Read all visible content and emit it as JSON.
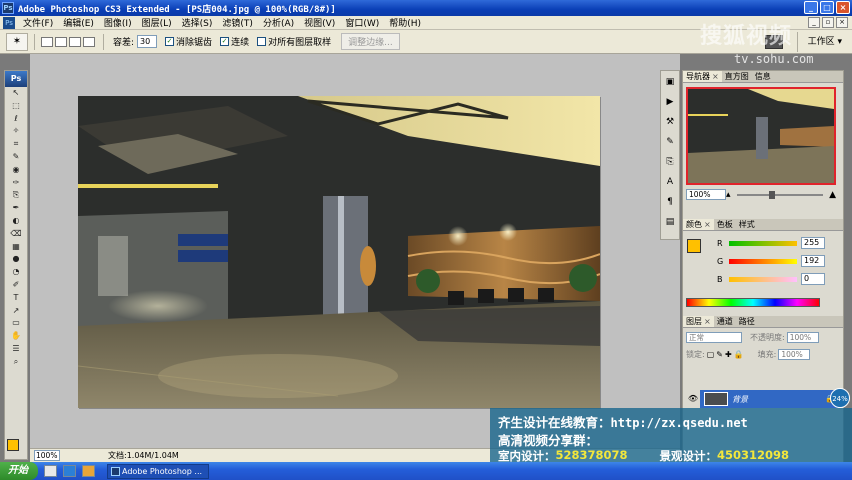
{
  "window": {
    "title": "Adobe Photoshop CS3 Extended - [PS店004.jpg @ 100%(RGB/8#)]",
    "minimize": "_",
    "maximize": "□",
    "close": "×"
  },
  "menu": {
    "items": [
      "文件(F)",
      "编辑(E)",
      "图像(I)",
      "图层(L)",
      "选择(S)",
      "滤镜(T)",
      "分析(A)",
      "视图(V)",
      "窗口(W)",
      "帮助(H)"
    ]
  },
  "options": {
    "tolerance_label": "容差:",
    "tolerance_value": "30",
    "antialias_label": "消除锯齿",
    "contiguous_label": "连续",
    "sample_all_label": "对所有图层取样",
    "refine_edge_label": "调整边缘...",
    "workspace_label": "工作区 ▾"
  },
  "toolbox": {
    "logo": "Ps",
    "tools": [
      "↖",
      "⬚",
      "ℓ",
      "✧",
      "⌗",
      "✎",
      "◉",
      "✑",
      "⎘",
      "✒",
      "◐",
      "⌫",
      "▦",
      "●",
      "◔",
      "✐",
      "T",
      "↗",
      "▭",
      "✋",
      "☰",
      "⌕"
    ]
  },
  "document": {
    "zoom": "100%",
    "doc_info": "文档:1.04M/1.04M"
  },
  "colors": {
    "foreground": "#ffc000",
    "background": "#ffffff",
    "accent_select": "#3168c4",
    "nav_frame": "#e0232b"
  },
  "navigator": {
    "tabs": [
      "导航器",
      "直方图",
      "信息"
    ],
    "zoom": "100%"
  },
  "color_panel": {
    "tabs": [
      "颜色",
      "色板",
      "样式"
    ],
    "r_label": "R",
    "g_label": "G",
    "b_label": "B",
    "r": 255,
    "g": 192,
    "b": 0
  },
  "layers_panel": {
    "tabs": [
      "图层",
      "通道",
      "路径"
    ],
    "blend_mode": "正常",
    "opacity_label": "不透明度:",
    "opacity_value": "100%",
    "lock_label": "锁定:",
    "fill_label": "填充:",
    "fill_value": "100%",
    "layer_name": "背景"
  },
  "watermark": {
    "brand": "搜狐视频",
    "url": "tv.sohu.com"
  },
  "overlay": {
    "line1_a": "齐生设计在线教育：",
    "line1_url": "http://zx.qsedu.net",
    "line2": "高清视频分享群：",
    "group1_label": "室内设计：",
    "group1_number": "528378078",
    "group2_label": "景观设计：",
    "group2_number": "450312098",
    "float_badge": "24%"
  },
  "taskbar": {
    "start": "开始",
    "task_label": "Adobe Photoshop ..."
  }
}
